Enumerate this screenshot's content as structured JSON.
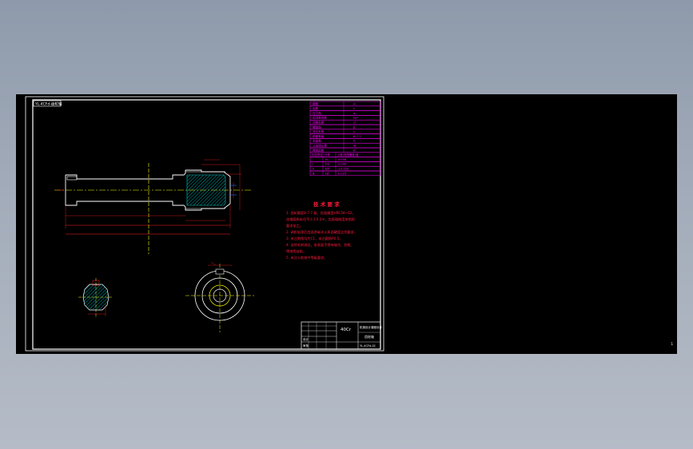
{
  "sheet": {
    "title_tag": "YL-4CFd-齿轮轴",
    "page_number": "1"
  },
  "tech_requirements": {
    "heading": "技 术 要 求",
    "lines": [
      "1. 齿轮精度8-7-7 级，齿面硬度HRC58~62，",
      "   齿根圆角半径不小于0.2m，齿面粗糙度按图纸",
      "   要求加工。",
      "2. 调质处理后齿面渗碳淬火表面硬度达到要求，",
      "3. 未注倒角均为C1，未注圆角R0.5。",
      "4. 去除毛刺锐边，各表面不得有碰伤、划痕、",
      "   锈蚀等缺陷，",
      "5. 未注公差按中等级要求。"
    ]
  },
  "gear_table": {
    "rows": [
      [
        "模数",
        "m"
      ],
      [
        "齿数",
        "z"
      ],
      [
        "压力角",
        "α"
      ],
      [
        "齿顶高系数",
        "ha*"
      ],
      [
        "顶隙系数",
        "c*"
      ],
      [
        "螺旋角",
        "β"
      ],
      [
        "变位系数",
        "x"
      ],
      [
        "精度等级",
        "8-7-7"
      ],
      [
        "全齿高",
        "h"
      ],
      [
        "公法线长度",
        "W"
      ],
      [
        "跨测齿数",
        "K"
      ]
    ],
    "check_header": [
      "检验项目",
      "代号",
      "公差(极限偏差)值"
    ],
    "check_rows": [
      [
        "",
        "Fr",
        "0.056"
      ],
      [
        "Ⅰ",
        "Fw",
        "0.040"
      ],
      [
        "Ⅱ",
        "fpt",
        "±0.020"
      ],
      [
        "Ⅲ",
        "Fβ",
        "0.025"
      ]
    ]
  },
  "title_block": {
    "material": "40Cr",
    "designer_label": "设计",
    "checker_label": "审核",
    "drawing_name": "齿轮轴",
    "drawing_no": "YL-4CFd-02",
    "school": "机械设计课程设计"
  },
  "colors": {
    "border": "#ffffff",
    "outline": "#ffffff",
    "dimension": "#ff2020",
    "centerline": "#ffff00",
    "hatch": "#00c8c8",
    "table": "#ff00ff",
    "text_red": "#ff1a3c",
    "blue": "#1e6bff"
  }
}
